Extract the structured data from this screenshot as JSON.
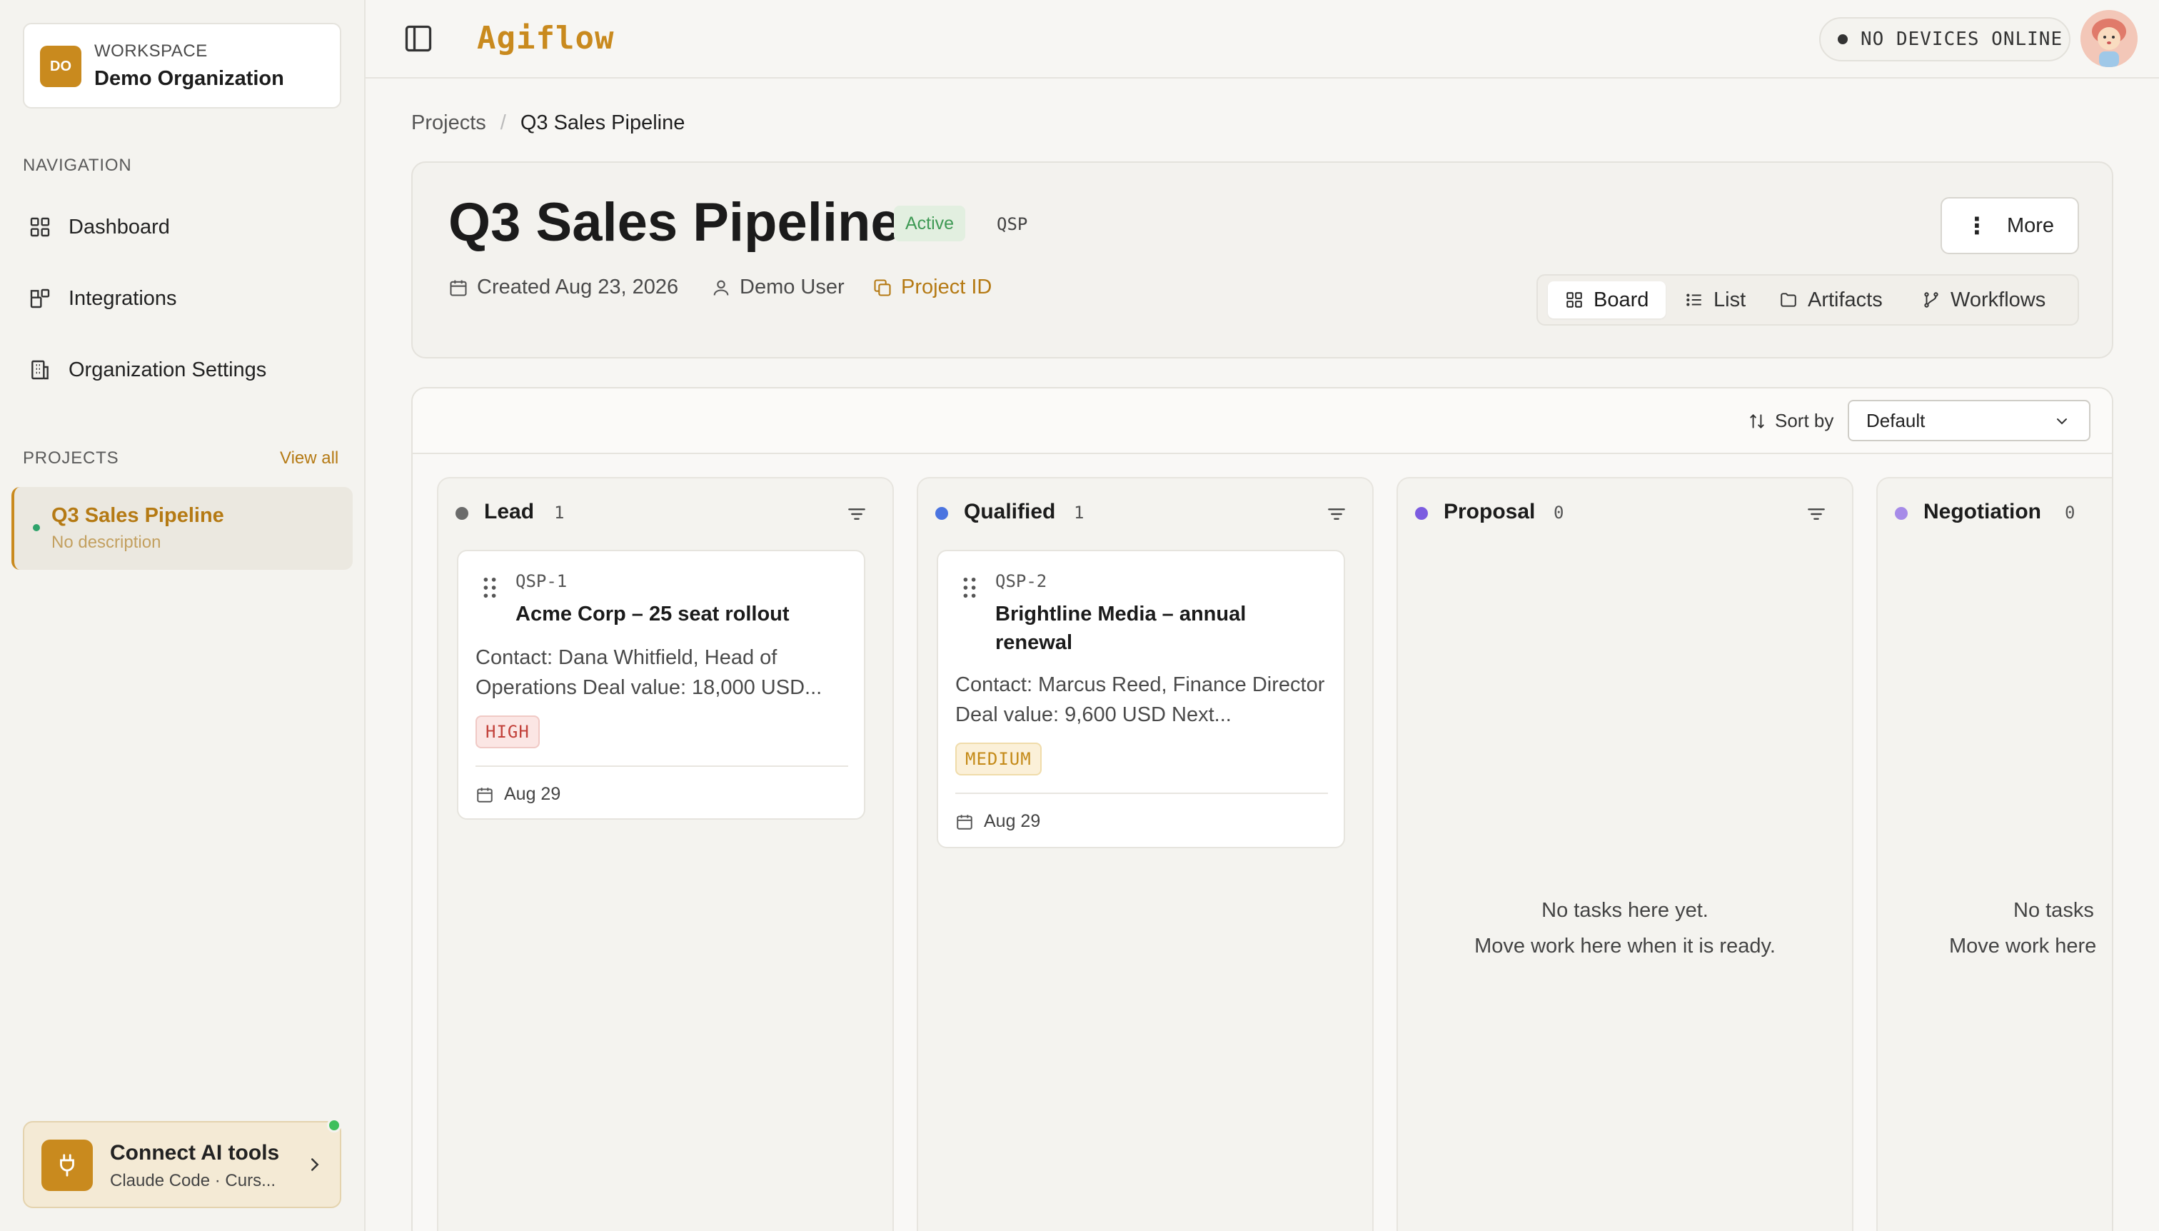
{
  "workspace": {
    "initials": "DO",
    "label": "WORKSPACE",
    "name": "Demo Organization"
  },
  "sidebar": {
    "nav_label": "NAVIGATION",
    "nav_items": [
      {
        "label": "Dashboard",
        "icon": "grid-icon"
      },
      {
        "label": "Integrations",
        "icon": "integrations-icon"
      },
      {
        "label": "Organization Settings",
        "icon": "building-icon"
      }
    ],
    "projects_label": "PROJECTS",
    "view_all": "View all",
    "projects": [
      {
        "name": "Q3 Sales Pipeline",
        "description": "No description"
      }
    ],
    "connect": {
      "title": "Connect AI tools",
      "subtitle": "Claude Code · Curs..."
    }
  },
  "topbar": {
    "logo": "Agiflow",
    "devices": "NO DEVICES ONLINE"
  },
  "breadcrumb": {
    "root": "Projects",
    "separator": "/",
    "current": "Q3 Sales Pipeline"
  },
  "project": {
    "title": "Q3 Sales Pipeline",
    "status": "Active",
    "key": "QSP",
    "created": "Created Aug 23, 2026",
    "owner": "Demo User",
    "project_id_label": "Project ID",
    "more_label": "More"
  },
  "views": {
    "tabs": [
      {
        "label": "Board",
        "icon": "board-icon",
        "active": true
      },
      {
        "label": "List",
        "icon": "list-icon",
        "active": false
      },
      {
        "label": "Artifacts",
        "icon": "folder-icon",
        "active": false
      },
      {
        "label": "Workflows",
        "icon": "workflow-icon",
        "active": false
      }
    ]
  },
  "board": {
    "sort_label": "Sort by",
    "sort_value": "Default",
    "empty_line1": "No tasks here yet.",
    "empty_line2": "Move work here when it is ready.",
    "columns": [
      {
        "name": "Lead",
        "count": "1",
        "color": "#6b6b6b",
        "tasks": [
          {
            "key": "QSP-1",
            "title": "Acme Corp – 25 seat rollout",
            "description": "Contact: Dana Whitfield, Head of Operations Deal value: 18,000 USD...",
            "priority": "HIGH",
            "date": "Aug 29"
          }
        ]
      },
      {
        "name": "Qualified",
        "count": "1",
        "color": "#4b74e0",
        "tasks": [
          {
            "key": "QSP-2",
            "title": "Brightline Media – annual renewal",
            "description": "Contact: Marcus Reed, Finance Director Deal value: 9,600 USD Next...",
            "priority": "MEDIUM",
            "date": "Aug 29"
          }
        ]
      },
      {
        "name": "Proposal",
        "count": "0",
        "color": "#7c5ce0",
        "tasks": []
      },
      {
        "name": "Negotiation",
        "count": "0",
        "color": "#a68be8",
        "tasks": []
      }
    ],
    "truncated_empty_line1": "No tasks",
    "truncated_empty_line2": "Move work here"
  }
}
